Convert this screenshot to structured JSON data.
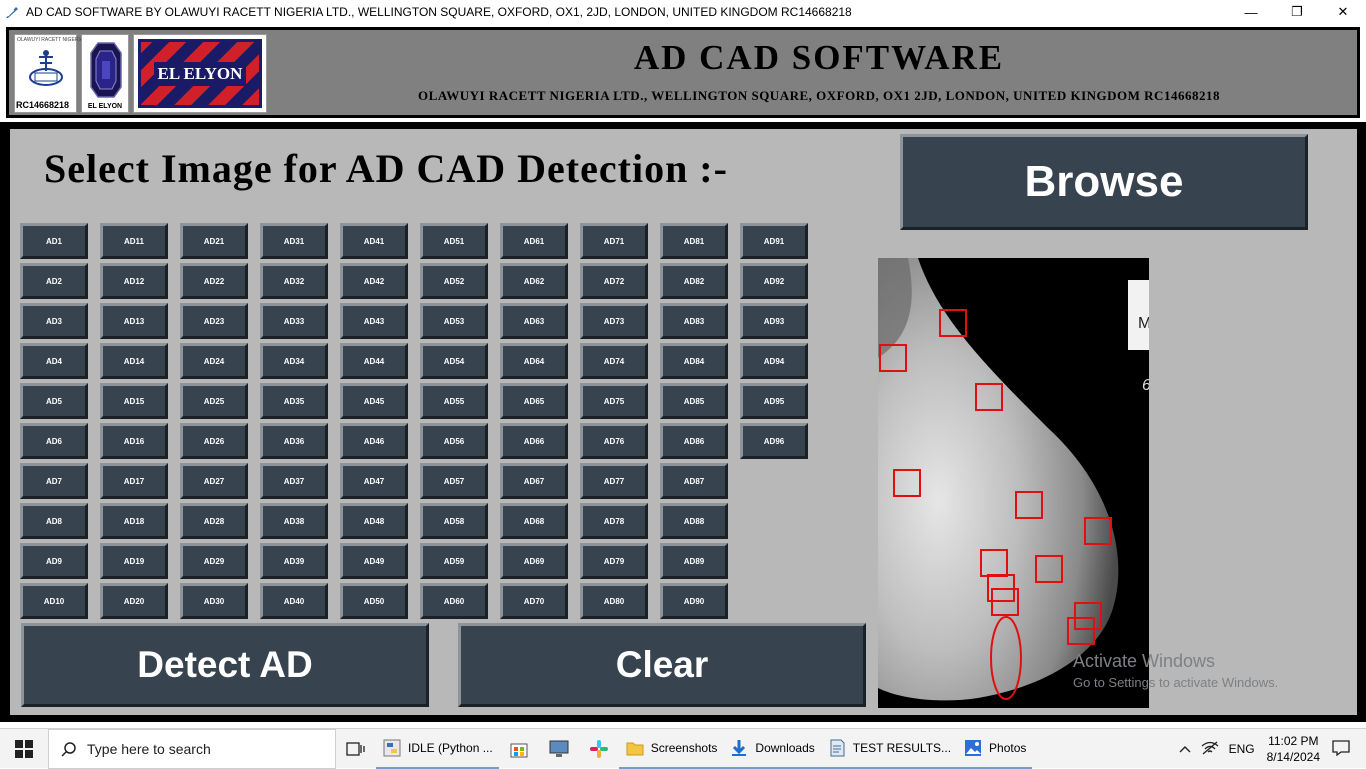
{
  "window": {
    "title": "AD CAD SOFTWARE BY OLAWUYI RACETT NIGERIA LTD., WELLINGTON SQUARE, OXFORD, OX1, 2JD, LONDON, UNITED KINGDOM RC14668218",
    "controls": {
      "minimize": "—",
      "restore": "❐",
      "close": "✕"
    }
  },
  "header": {
    "title": "AD CAD SOFTWARE",
    "subtitle": "OLAWUYI RACETT NIGERIA LTD., WELLINGTON SQUARE, OXFORD, OX1 2JD, LONDON, UNITED KINGDOM RC14668218",
    "logo1_small_text": "OLAWUYI RACETT NIGERIA LTD.",
    "logo1_rc": "RC14668218",
    "logo2_caption": "EL ELYON",
    "logo3_text": "EL ELYON"
  },
  "main": {
    "select_label": "Select Image for AD CAD Detection :-",
    "browse_label": "Browse",
    "detect_label": "Detect AD",
    "clear_label": "Clear",
    "ad_columns": [
      [
        "AD1",
        "AD2",
        "AD3",
        "AD4",
        "AD5",
        "AD6",
        "AD7",
        "AD8",
        "AD9",
        "AD10"
      ],
      [
        "AD11",
        "AD12",
        "AD13",
        "AD14",
        "AD15",
        "AD16",
        "AD17",
        "AD18",
        "AD19",
        "AD20"
      ],
      [
        "AD21",
        "AD22",
        "AD23",
        "AD24",
        "AD25",
        "AD26",
        "AD27",
        "AD28",
        "AD29",
        "AD30"
      ],
      [
        "AD31",
        "AD32",
        "AD33",
        "AD34",
        "AD35",
        "AD36",
        "AD37",
        "AD38",
        "AD39",
        "AD40"
      ],
      [
        "AD41",
        "AD42",
        "AD43",
        "AD44",
        "AD45",
        "AD46",
        "AD47",
        "AD48",
        "AD49",
        "AD50"
      ],
      [
        "AD51",
        "AD52",
        "AD53",
        "AD54",
        "AD55",
        "AD56",
        "AD57",
        "AD58",
        "AD59",
        "AD60"
      ],
      [
        "AD61",
        "AD62",
        "AD63",
        "AD64",
        "AD65",
        "AD66",
        "AD67",
        "AD68",
        "AD69",
        "AD70"
      ],
      [
        "AD71",
        "AD72",
        "AD73",
        "AD74",
        "AD75",
        "AD76",
        "AD77",
        "AD78",
        "AD79",
        "AD80"
      ],
      [
        "AD81",
        "AD82",
        "AD83",
        "AD84",
        "AD85",
        "AD86",
        "AD87",
        "AD88",
        "AD89",
        "AD90"
      ],
      [
        "AD91",
        "AD92",
        "AD93",
        "AD94",
        "AD95",
        "AD96"
      ]
    ],
    "image_label_fragment_1": "M",
    "image_label_fragment_2": "6",
    "detection_box_count": 13,
    "detection_ellipse_count": 1
  },
  "watermark": {
    "line1": "Activate Windows",
    "line2": "Go to Settings to activate Windows."
  },
  "taskbar": {
    "search_placeholder": "Type here to search",
    "apps": [
      {
        "label": "IDLE (Python ...",
        "icon": "python-icon"
      },
      {
        "label": "Screenshots",
        "icon": "folder-icon"
      },
      {
        "label": "Downloads",
        "icon": "download-icon"
      },
      {
        "label": "TEST RESULTS...",
        "icon": "document-icon"
      },
      {
        "label": "Photos",
        "icon": "photos-icon"
      }
    ],
    "language": "ENG",
    "time": "11:02 PM",
    "date": "8/14/2024"
  },
  "colors": {
    "button_face": "#37444f",
    "panel": "#b8b8b8",
    "header_bg": "#808080",
    "detection_red": "#e01010"
  }
}
